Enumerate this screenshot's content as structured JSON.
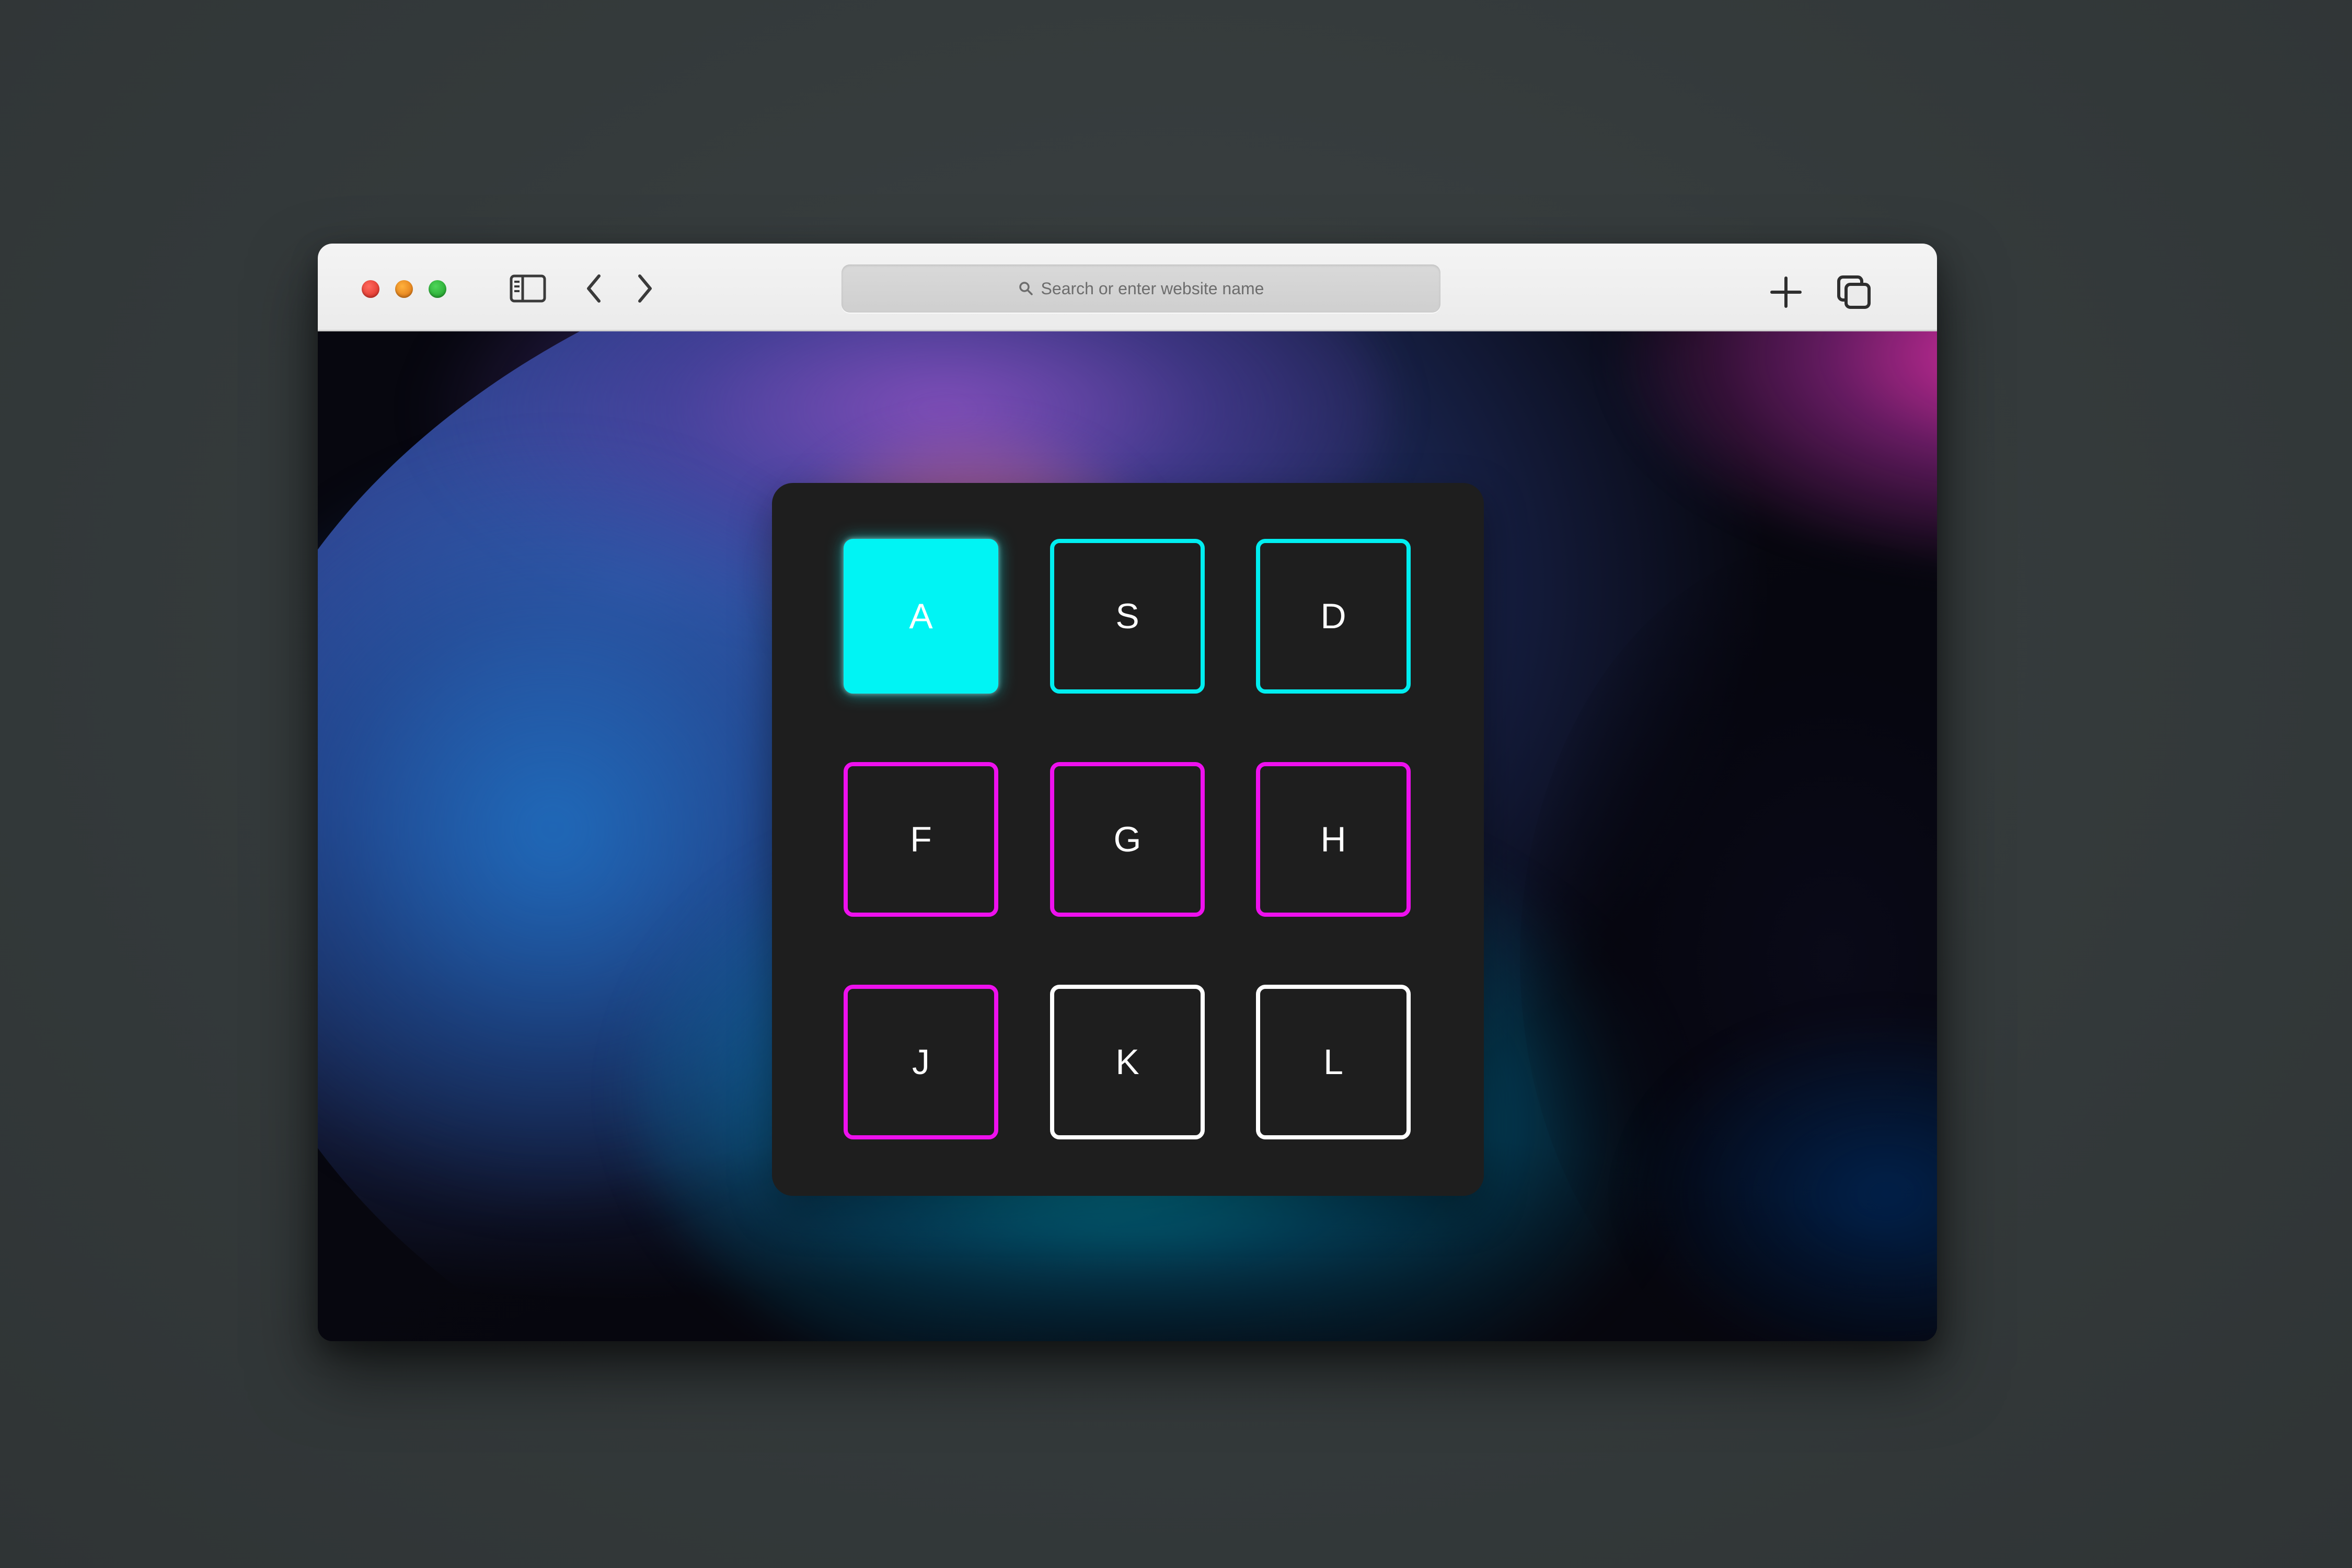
{
  "browser": {
    "address_bar": {
      "placeholder": "Search or enter website name"
    },
    "traffic_lights": [
      "close",
      "minimize",
      "zoom"
    ],
    "icons": {
      "sidebar": "sidebar-icon",
      "back": "chevron-left-icon",
      "forward": "chevron-right-icon",
      "search": "search-icon",
      "new_tab": "plus-icon",
      "tabs": "tab-overview-icon"
    }
  },
  "keypad": {
    "active_key": "A",
    "colors": {
      "cyan": "#00eef0",
      "magenta": "#ee10ee",
      "white": "#ffffff",
      "active_fill": "#00f4f4",
      "panel": "#1e1e1e"
    },
    "keys": [
      {
        "label": "A",
        "color": "cyan",
        "active": true
      },
      {
        "label": "S",
        "color": "cyan",
        "active": false
      },
      {
        "label": "D",
        "color": "cyan",
        "active": false
      },
      {
        "label": "F",
        "color": "magenta",
        "active": false
      },
      {
        "label": "G",
        "color": "magenta",
        "active": false
      },
      {
        "label": "H",
        "color": "magenta",
        "active": false
      },
      {
        "label": "J",
        "color": "magenta",
        "active": false
      },
      {
        "label": "K",
        "color": "white",
        "active": false
      },
      {
        "label": "L",
        "color": "white",
        "active": false
      }
    ]
  }
}
